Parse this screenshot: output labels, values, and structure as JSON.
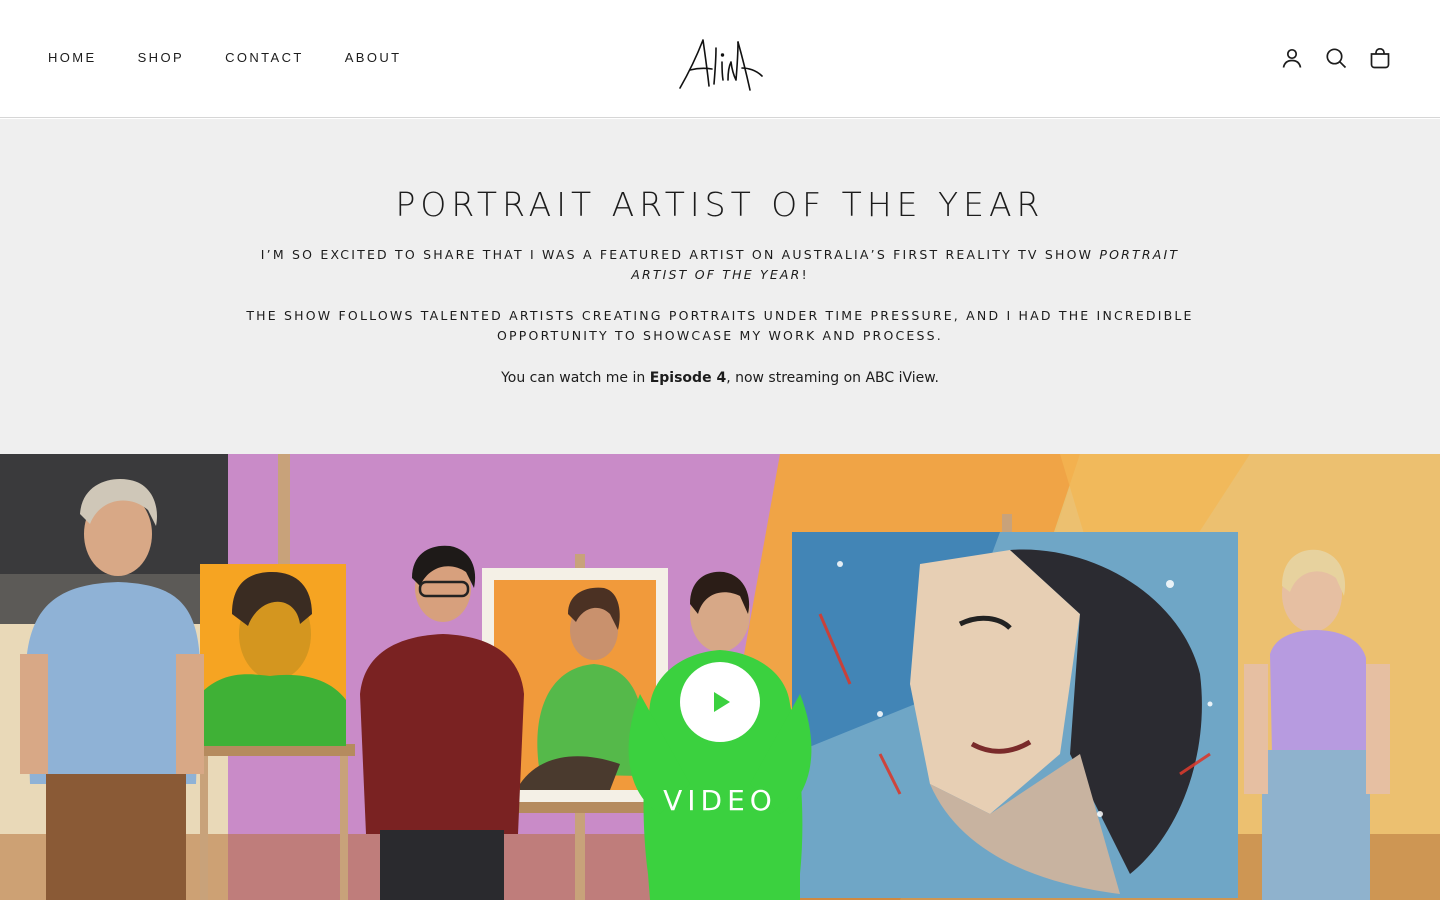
{
  "header": {
    "nav": [
      {
        "label": "HOME"
      },
      {
        "label": "SHOP"
      },
      {
        "label": "CONTACT"
      },
      {
        "label": "ABOUT"
      }
    ],
    "logo_text": "AliNA",
    "icons": [
      "account-icon",
      "search-icon",
      "cart-icon"
    ]
  },
  "intro": {
    "title": "PORTRAIT ARTIST OF THE YEAR",
    "p1_main": "I’M SO EXCITED TO SHARE THAT I WAS A FEATURED ARTIST ON AUSTRALIA’S FIRST REALITY TV SHOW ",
    "p1_italic": "PORTRAIT ARTIST OF THE YEAR",
    "p1_end": "!",
    "p2": "THE SHOW FOLLOWS TALENTED ARTISTS CREATING PORTRAITS UNDER TIME PRESSURE, AND I HAD THE INCREDIBLE OPPORTUNITY TO SHOWCASE MY WORK AND PROCESS.",
    "p3_start": "You can watch me in ",
    "p3_bold": "Episode 4",
    "p3_end": ", now streaming on ABC iView."
  },
  "video": {
    "label": "VIDEO"
  },
  "colors": {
    "header_bg": "#ffffff",
    "intro_bg": "#efefef",
    "text": "#1c1c1c",
    "wall_purple": "#c98bc8",
    "wall_orange": "#f0a446",
    "wall_yellow": "#ecc070",
    "dress_green": "#3bd13f"
  }
}
